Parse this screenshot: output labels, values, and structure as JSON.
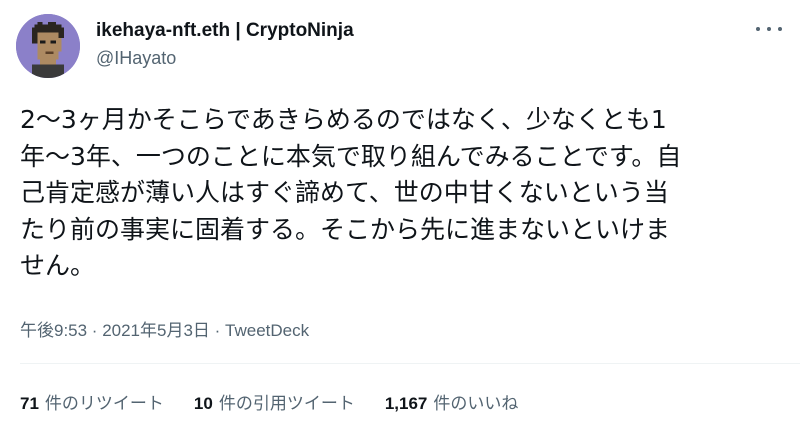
{
  "author": {
    "display_name": "ikehaya-nft.eth | CryptoNinja",
    "handle": "@IHayato",
    "avatar_icon": "pixel-art-avatar-icon",
    "avatar_bg": "#8b80c9"
  },
  "tweet": {
    "text": "2〜3ヶ月かそこらであきらめるのではなく、少なくとも1\n年〜3年、一つのことに本気で取り組んでみることです。自\n己肯定感が薄い人はすぐ諦めて、世の中甘くないという当\nたり前の事実に固着する。そこから先に進まないといけま\nせん。"
  },
  "meta": {
    "timestamp": "午後9:53 · 2021年5月3日 · ",
    "source": "TweetDeck"
  },
  "stats": {
    "retweets_count": "71",
    "retweets_label": "件のリツイート",
    "quotes_count": "10",
    "quotes_label": "件の引用ツイート",
    "likes_count": "1,167",
    "likes_label": "件のいいね"
  },
  "more_icon": "more-dots-icon"
}
